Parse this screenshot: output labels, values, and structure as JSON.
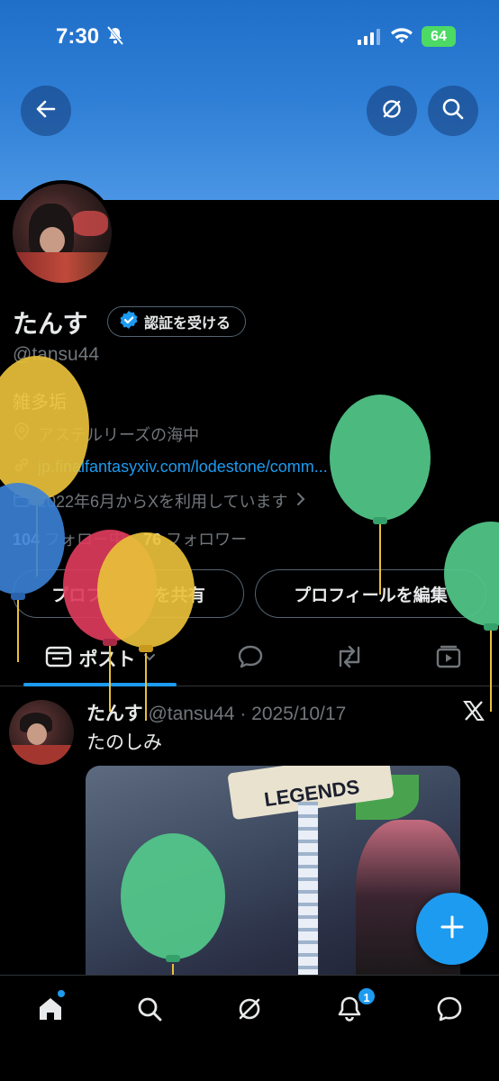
{
  "status_bar": {
    "time": "7:30",
    "battery": "64"
  },
  "header": {
    "back_icon": "arrow-left-icon",
    "grok_icon": "grok-icon",
    "search_icon": "search-icon"
  },
  "profile": {
    "name": "たんす",
    "verify_label": "認証を受ける",
    "handle": "@tansu44",
    "bio": "雑多垢",
    "location": "アステルリーズの海中",
    "link": "jp.finalfantasyxiv.com/lodestone/comm...",
    "joined": "2022年6月からXを利用しています",
    "following_count": "104",
    "following_label": "フォロー中",
    "followers_count": "76",
    "followers_label": "フォロワー",
    "share_button": "プロフィールを共有",
    "edit_button": "プロフィールを編集"
  },
  "tabs": {
    "posts_label": "ポスト"
  },
  "post": {
    "author": "たんす",
    "handle_date": "@tansu44 · 2025/10/17",
    "text": "たのしみ",
    "image_text": "LEGENDS"
  },
  "bottom_nav": {
    "notifications_badge": "1"
  },
  "colors": {
    "accent": "#1d9bf0",
    "banner": "#2f7fd6",
    "balloon_yellow": "#e8c03a",
    "balloon_green": "#52c98a",
    "balloon_red": "#dd3b5c",
    "balloon_blue": "#3b82d6"
  }
}
